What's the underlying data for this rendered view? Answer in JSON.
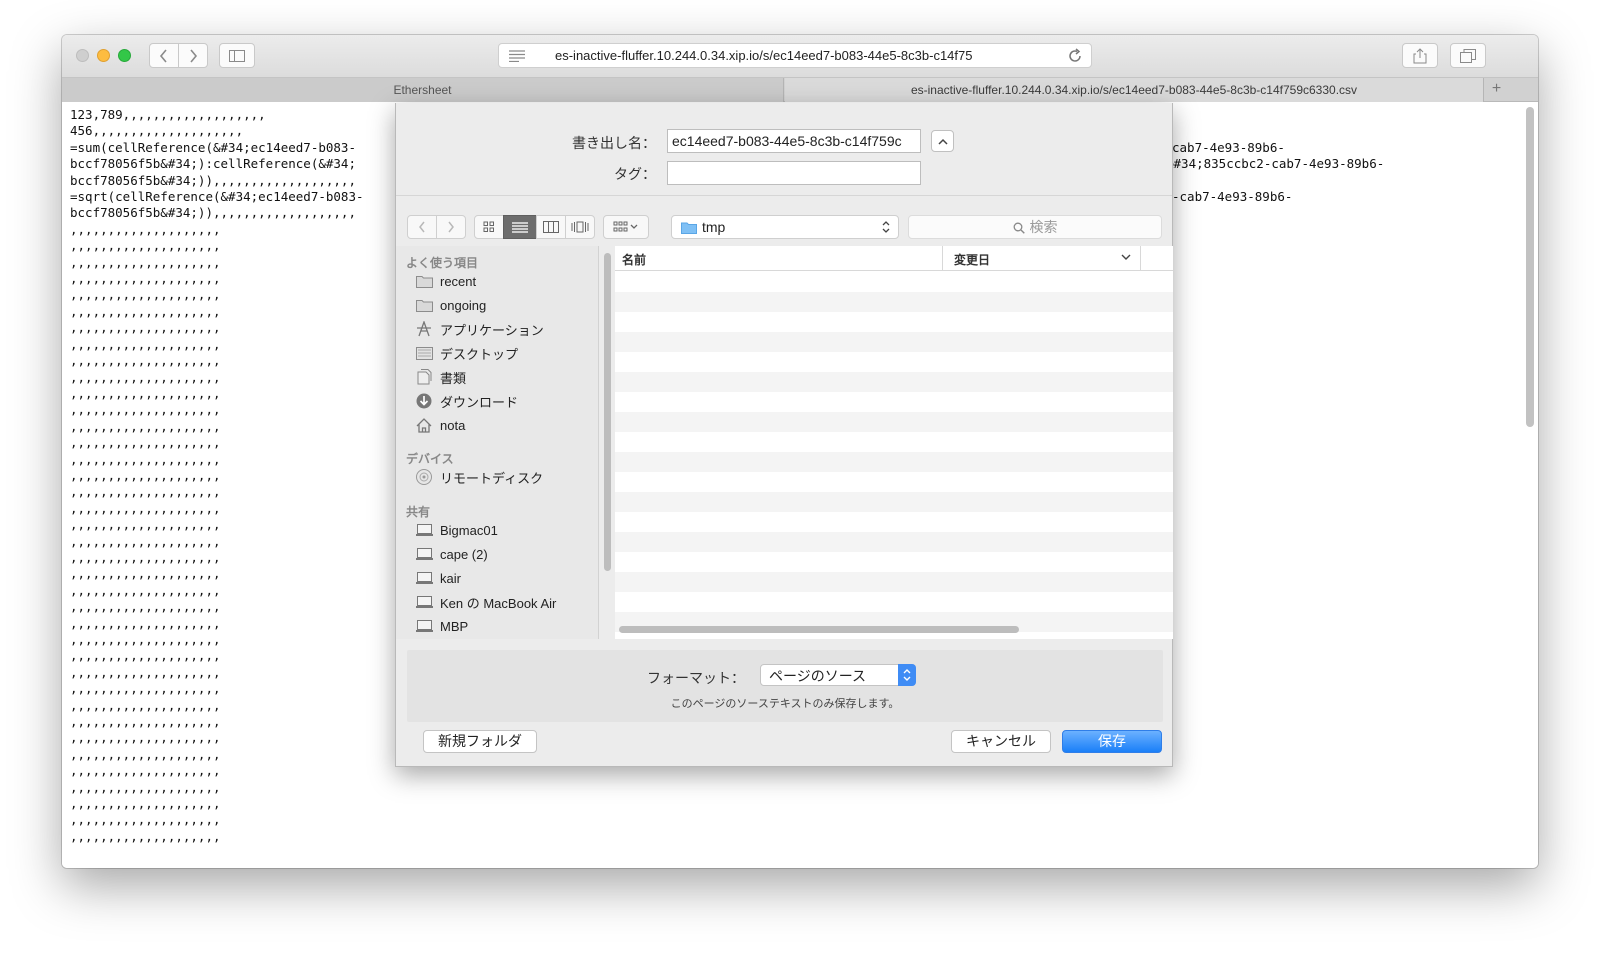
{
  "browser": {
    "url": "es-inactive-fluffer.10.244.0.34.xip.io/s/ec14eed7-b083-44e5-8c3b-c14f75",
    "tabs": [
      {
        "label": "Ethersheet"
      },
      {
        "label": "es-inactive-fluffer.10.244.0.34.xip.io/s/ec14eed7-b083-44e5-8c3b-c14f759c6330.csv"
      }
    ],
    "new_tab_symbol": "+"
  },
  "page": {
    "source_lines": [
      "123,789,,,,,,,,,,,,,,,,,,,",
      "456,,,,,,,,,,,,,,,,,,,,",
      "=sum(cellReference(&#34;ec14eed7-b083-",
      "bccf78056f5b&#34;):cellReference(&#34;",
      "bccf78056f5b&#34;)),,,,,,,,,,,,,,,,,,,",
      "=sqrt(cellReference(&#34;ec14eed7-b083-",
      "bccf78056f5b&#34;)),,,,,,,,,,,,,,,,,,,"
    ],
    "source_right_lines": [
      "cab7-4e93-89b6-",
      "&#34;835ccbc2-cab7-4e93-89b6-",
      "",
      "-cab7-4e93-89b6-"
    ],
    "filler_line": ",,,,,,,,,,,,,,,,,,,,",
    "filler_count": 38
  },
  "save_dialog": {
    "filename_label": "書き出し名：",
    "filename_value": "ec14eed7-b083-44e5-8c3b-c14f759c",
    "tags_label": "タグ：",
    "tags_value": "",
    "location": "tmp",
    "search_placeholder": "検索",
    "sidebar": {
      "favorites_heading": "よく使う項目",
      "favorites": [
        {
          "label": "recent",
          "icon": "folder-icon"
        },
        {
          "label": "ongoing",
          "icon": "folder-icon"
        },
        {
          "label": "アプリケーション",
          "icon": "applications-icon"
        },
        {
          "label": "デスクトップ",
          "icon": "desktop-icon"
        },
        {
          "label": "書類",
          "icon": "documents-icon"
        },
        {
          "label": "ダウンロード",
          "icon": "downloads-icon"
        },
        {
          "label": "nota",
          "icon": "home-icon"
        }
      ],
      "devices_heading": "デバイス",
      "devices": [
        {
          "label": "リモートディスク",
          "icon": "disc-icon"
        }
      ],
      "shared_heading": "共有",
      "shared": [
        {
          "label": "Bigmac01",
          "icon": "computer-icon"
        },
        {
          "label": "cape (2)",
          "icon": "computer-icon"
        },
        {
          "label": "kair",
          "icon": "computer-icon"
        },
        {
          "label": "Ken の MacBook Air",
          "icon": "computer-icon"
        },
        {
          "label": "MBP",
          "icon": "computer-icon"
        }
      ]
    },
    "columns": {
      "name": "名前",
      "date_modified": "変更日"
    },
    "format_label": "フォーマット：",
    "format_value": "ページのソース",
    "format_note": "このページのソーステキストのみ保存します。",
    "new_folder_label": "新規フォルダ",
    "cancel_label": "キャンセル",
    "save_label": "保存",
    "accent_color": "#1a7ff8"
  }
}
